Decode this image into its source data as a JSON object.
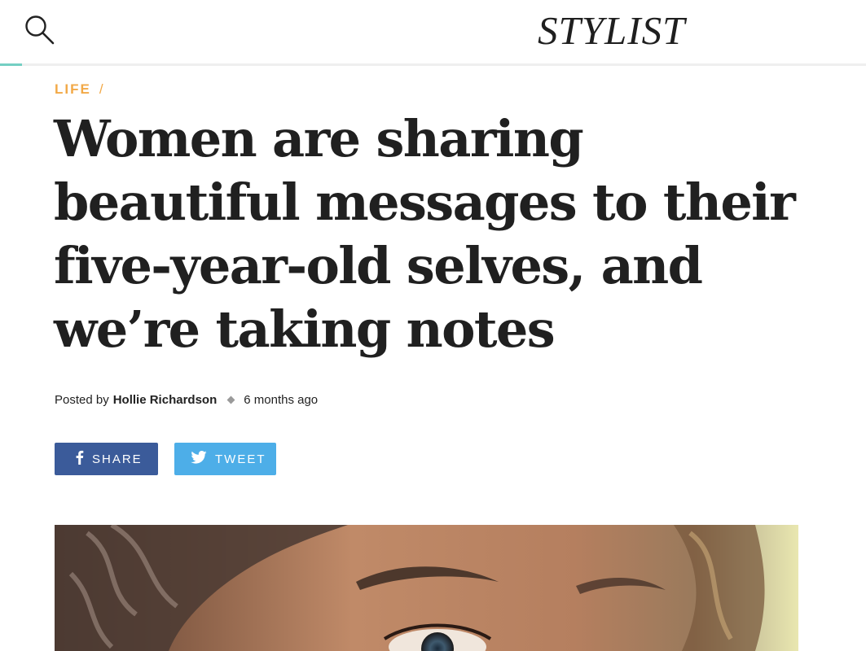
{
  "header": {
    "logo": "STYLIST",
    "search_icon": "search-icon",
    "progress": 0.025,
    "accent_color": "#74cfc3"
  },
  "article": {
    "section": "LIFE",
    "section_separator": "/",
    "section_color": "#f2a947",
    "headline": "Women are sharing beautiful messages to their five-year-old selves, and we’re taking notes",
    "byline": {
      "prefix": "Posted by",
      "author": "Hollie Richardson",
      "time": "6 months ago"
    },
    "share": {
      "facebook_label": "SHARE",
      "facebook_icon": "facebook-icon",
      "facebook_color": "#3b5b9a",
      "twitter_label": "TWEET",
      "twitter_icon": "twitter-icon",
      "twitter_color": "#4daee8"
    },
    "hero_image": "close-up photo of a woman's face with curly hair"
  }
}
